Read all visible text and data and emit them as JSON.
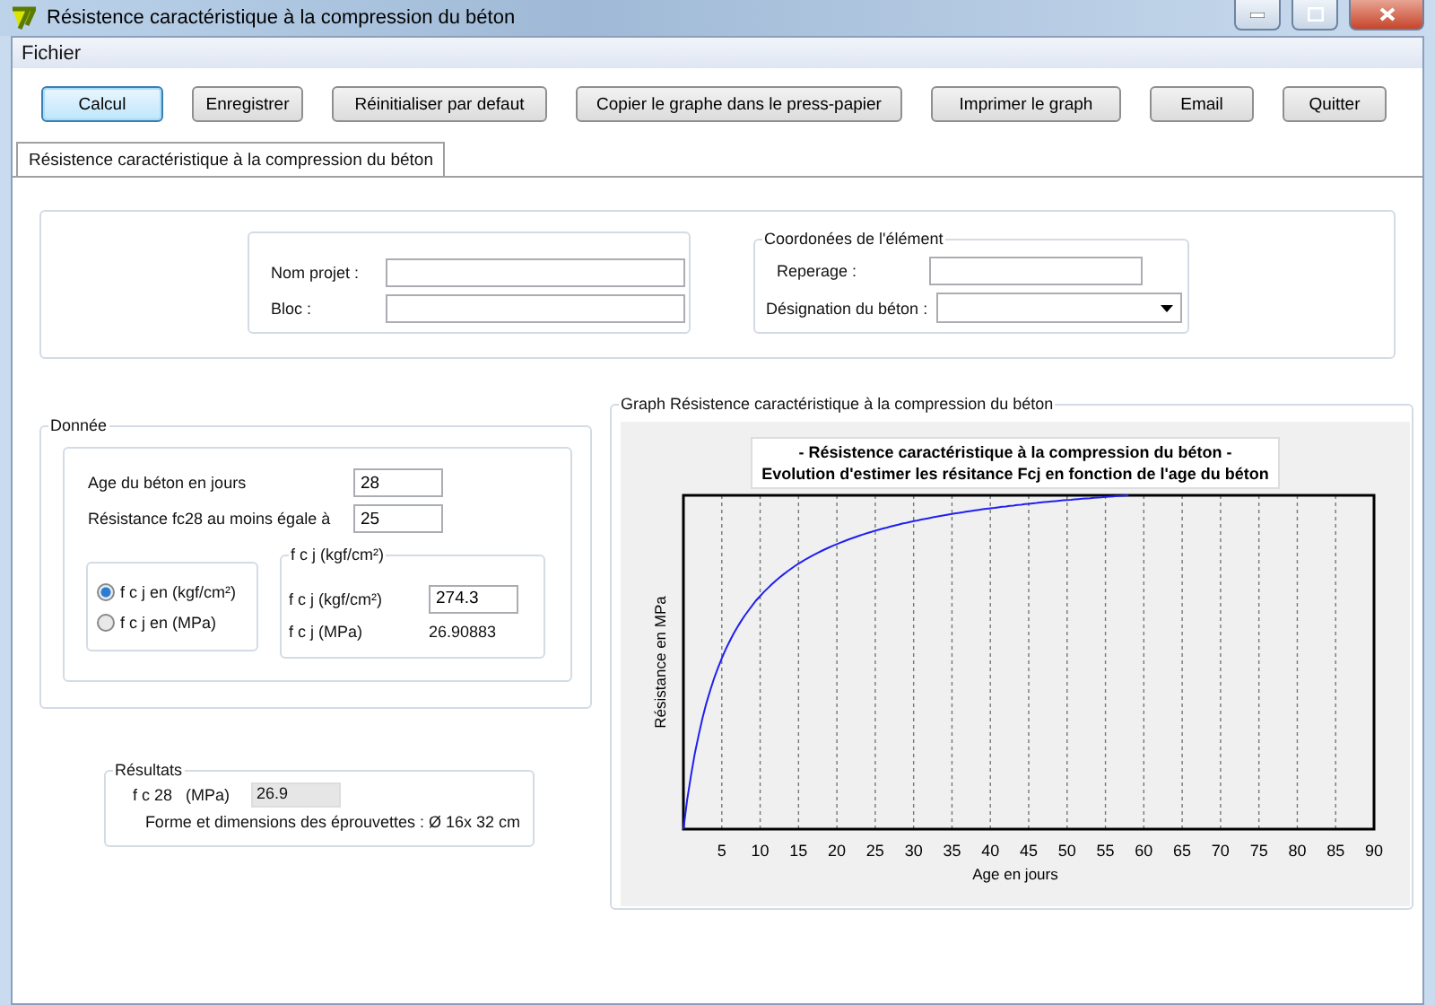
{
  "window": {
    "title": "Résistence caractéristique à la compression du béton"
  },
  "menu": [
    {
      "label": "Fichier"
    }
  ],
  "toolbar": [
    {
      "label": "Calcul",
      "focused": true
    },
    {
      "label": "Enregistrer",
      "focused": false
    },
    {
      "label": "Réinitialiser par defaut",
      "focused": false
    },
    {
      "label": "Copier le graphe dans le press-papier",
      "focused": false
    },
    {
      "label": "Imprimer le graph",
      "focused": false
    },
    {
      "label": "Email",
      "focused": false
    },
    {
      "label": "Quitter",
      "focused": false
    }
  ],
  "tabs": [
    {
      "label": "Résistence caractéristique à la compression du béton",
      "selected": true
    }
  ],
  "project": {
    "fields": [
      {
        "label": "Nom projet :"
      },
      {
        "label": "Bloc :"
      }
    ]
  },
  "element": {
    "legend": "Coordonées de l'élément",
    "fields": [
      {
        "label": "Reperage :",
        "kind": "text"
      },
      {
        "label": "Désignation du béton :",
        "kind": "select"
      }
    ]
  },
  "donnee": {
    "legend": "Donnée",
    "inputs": [
      {
        "label": "Age du béton en jours",
        "value": "28"
      },
      {
        "label": "Résistance fc28 au moins égale à",
        "value": "25"
      }
    ],
    "units": [
      {
        "label": "f c j  en (kgf/cm²)",
        "selected": true
      },
      {
        "label": "f c j  en (MPa)",
        "selected": false
      }
    ],
    "fcj": {
      "legend": "f c j (kgf/cm²)",
      "rows": [
        {
          "label": "f c j (kgf/cm²)",
          "value": "274.3",
          "kind": "input"
        },
        {
          "label": "f c j (MPa)",
          "value": "26.90883",
          "kind": "text"
        }
      ]
    }
  },
  "results": {
    "legend": "Résultats",
    "fc28_label": "f c 28   (MPa)",
    "fc28_value": "26.9",
    "specimen": "Forme et dimensions des éprouvettes : Ø 16x 32 cm"
  },
  "graph": {
    "legend": "Graph Résistence caractéristique à la compression du béton",
    "title_lines": [
      "- Résistence caractéristique à la compression du béton -",
      "Evolution d'estimer les résitance Fcj en fonction de l'age du béton"
    ],
    "ylabel": "Résistance en MPa",
    "xlabel": "Age en jours",
    "xtick_labels": [
      "5",
      "10",
      "15",
      "20",
      "25",
      "30",
      "35",
      "40",
      "45",
      "50",
      "55",
      "60",
      "65",
      "70",
      "75",
      "80",
      "85",
      "90"
    ]
  }
}
